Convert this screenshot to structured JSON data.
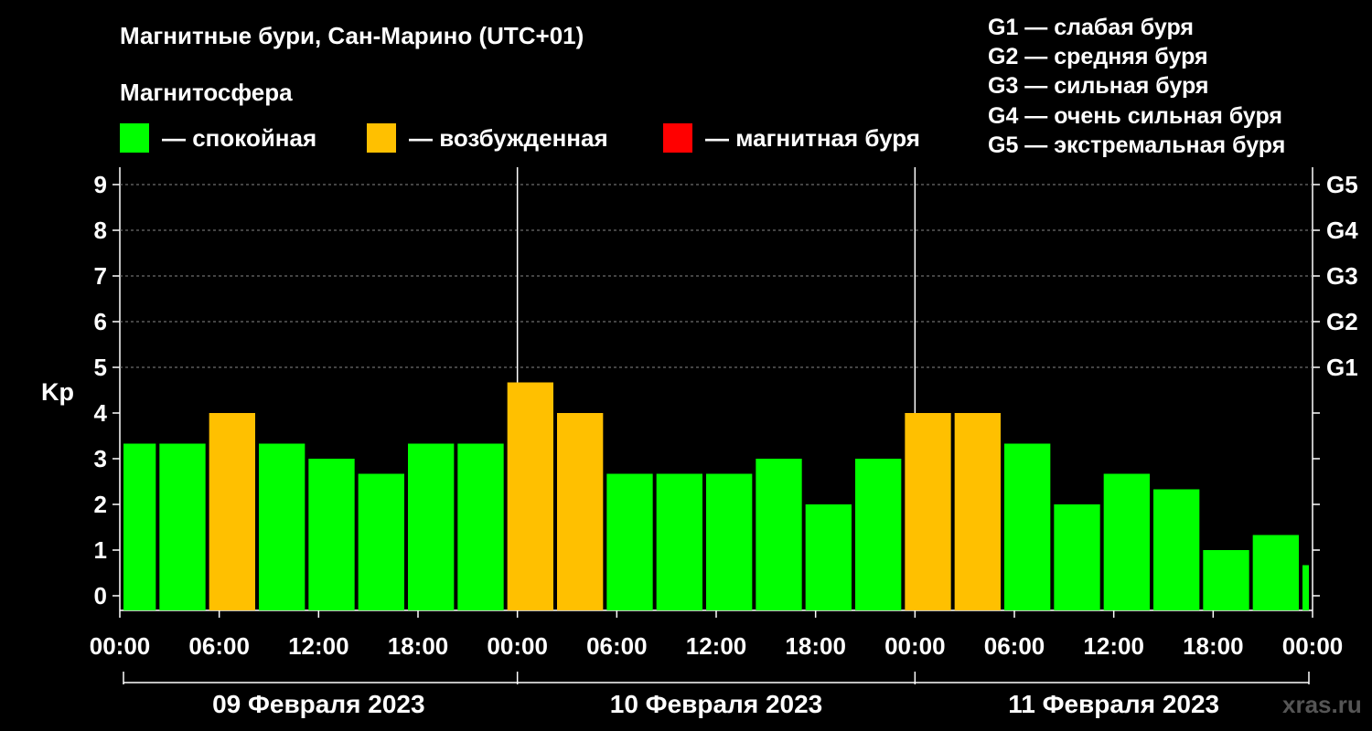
{
  "title": "Магнитные бури, Сан-Марино (UTC+01)",
  "subtitle": "Магнитосфера",
  "legend": {
    "calm": {
      "label": "— спокойная",
      "color": "#00ff00"
    },
    "excited": {
      "label": "— возбужденная",
      "color": "#ffc000"
    },
    "storm": {
      "label": "— магнитная буря",
      "color": "#ff0000"
    }
  },
  "g_legend": [
    "G1 — слабая буря",
    "G2 — средняя буря",
    "G3 — сильная буря",
    "G4 — очень сильная буря",
    "G5 — экстремальная буря"
  ],
  "watermark": "xras.ru",
  "chart_data": {
    "type": "bar",
    "ylabel": "Kp",
    "ylim": [
      0,
      9
    ],
    "grid": "dashed horizontal lines at Kp 5-9",
    "y_ticks": [
      "0",
      "1",
      "2",
      "3",
      "4",
      "5",
      "6",
      "7",
      "8",
      "9"
    ],
    "right_ticks": [
      {
        "value": 5,
        "label": "G1"
      },
      {
        "value": 6,
        "label": "G2"
      },
      {
        "value": 7,
        "label": "G3"
      },
      {
        "value": 8,
        "label": "G4"
      },
      {
        "value": 9,
        "label": "G5"
      }
    ],
    "x_tick_labels": [
      "00:00",
      "06:00",
      "12:00",
      "18:00",
      "00:00",
      "06:00",
      "12:00",
      "18:00",
      "00:00",
      "06:00",
      "12:00",
      "18:00",
      "00:00"
    ],
    "days": [
      "09 Февраля 2023",
      "10 Февраля 2023",
      "11 Февраля 2023"
    ],
    "bars": [
      {
        "start": "2023-02-09 00:00",
        "kp": 3.33,
        "state": "calm"
      },
      {
        "start": "2023-02-09 03:00",
        "kp": 3.33,
        "state": "calm"
      },
      {
        "start": "2023-02-09 06:00",
        "kp": 4.0,
        "state": "excited"
      },
      {
        "start": "2023-02-09 09:00",
        "kp": 3.33,
        "state": "calm"
      },
      {
        "start": "2023-02-09 12:00",
        "kp": 3.0,
        "state": "calm"
      },
      {
        "start": "2023-02-09 15:00",
        "kp": 2.67,
        "state": "calm"
      },
      {
        "start": "2023-02-09 18:00",
        "kp": 3.33,
        "state": "calm"
      },
      {
        "start": "2023-02-09 21:00",
        "kp": 3.33,
        "state": "calm"
      },
      {
        "start": "2023-02-10 00:00",
        "kp": 4.67,
        "state": "excited"
      },
      {
        "start": "2023-02-10 03:00",
        "kp": 4.0,
        "state": "excited"
      },
      {
        "start": "2023-02-10 06:00",
        "kp": 2.67,
        "state": "calm"
      },
      {
        "start": "2023-02-10 09:00",
        "kp": 2.67,
        "state": "calm"
      },
      {
        "start": "2023-02-10 12:00",
        "kp": 2.67,
        "state": "calm"
      },
      {
        "start": "2023-02-10 15:00",
        "kp": 3.0,
        "state": "calm"
      },
      {
        "start": "2023-02-10 18:00",
        "kp": 2.0,
        "state": "calm"
      },
      {
        "start": "2023-02-10 21:00",
        "kp": 3.0,
        "state": "calm"
      },
      {
        "start": "2023-02-11 00:00",
        "kp": 4.0,
        "state": "excited"
      },
      {
        "start": "2023-02-11 03:00",
        "kp": 4.0,
        "state": "excited"
      },
      {
        "start": "2023-02-11 06:00",
        "kp": 3.33,
        "state": "calm"
      },
      {
        "start": "2023-02-11 09:00",
        "kp": 2.0,
        "state": "calm"
      },
      {
        "start": "2023-02-11 12:00",
        "kp": 2.67,
        "state": "calm"
      },
      {
        "start": "2023-02-11 15:00",
        "kp": 2.33,
        "state": "calm"
      },
      {
        "start": "2023-02-11 18:00",
        "kp": 1.0,
        "state": "calm"
      },
      {
        "start": "2023-02-11 21:00",
        "kp": 1.33,
        "state": "calm"
      },
      {
        "start": "2023-02-12 00:00",
        "kp": 0.67,
        "state": "calm"
      }
    ]
  }
}
